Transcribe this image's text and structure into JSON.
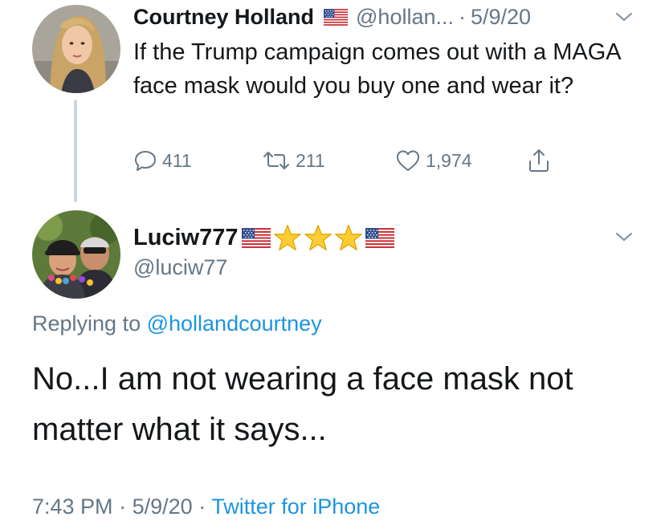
{
  "original_tweet": {
    "author_name": "Courtney Holland",
    "handle": "@hollan...",
    "separator": "·",
    "date": "5/9/20",
    "text": "If the Trump campaign comes out with a MAGA face mask would you buy one and wear it?",
    "reply_count": "411",
    "retweet_count": "211",
    "like_count": "1,974",
    "flag_icon": "us-flag-icon"
  },
  "reply_tweet": {
    "author_name": "Luciw777",
    "name_emojis": [
      "us-flag-icon",
      "star-icon",
      "star-icon",
      "star-icon",
      "us-flag-icon"
    ],
    "handle": "@luciw77",
    "replying_prefix": "Replying to ",
    "replying_to": "@hollandcourtney",
    "text": "No...I am not wearing a face mask not matter what it says...",
    "time": "7:43 PM",
    "separator": "·",
    "date": "5/9/20",
    "source": "Twitter for iPhone"
  },
  "colors": {
    "text_primary": "#14171a",
    "text_secondary": "#657786",
    "link": "#1b95e0",
    "thread_line": "#ccd6dd"
  }
}
